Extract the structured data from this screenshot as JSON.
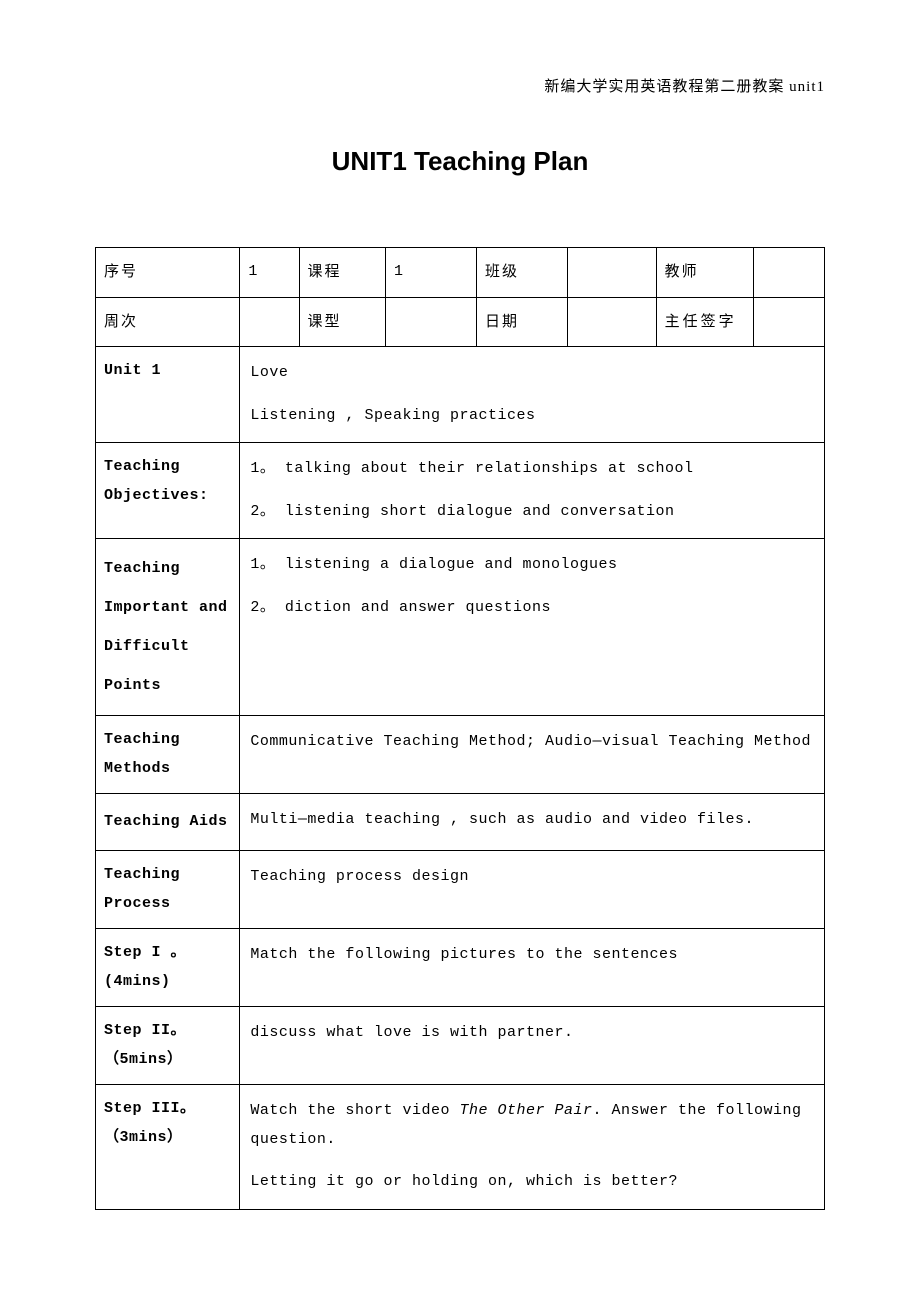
{
  "header": {
    "context": "新编大学实用英语教程第二册教案 unit1"
  },
  "title": "UNIT1 Teaching Plan",
  "row1": {
    "label": "序号",
    "val1": "1",
    "label2": "课程",
    "val2": "1",
    "label3": "班级",
    "val3": "",
    "label4": "教师",
    "val4": ""
  },
  "row2": {
    "label": "周次",
    "val1": "",
    "label2": "课型",
    "val2": "",
    "label3": "日期",
    "val3": "",
    "label4": "主任签字",
    "val4": ""
  },
  "unit": {
    "label": "Unit 1",
    "line1": "Love",
    "line2": "Listening , Speaking practices"
  },
  "objectives": {
    "label": "Teaching Objectives:",
    "line1": "1。  talking about their relationships at school",
    "line2": "2。  listening short dialogue and conversation"
  },
  "points": {
    "label": "Teaching Important and Difficult Points",
    "line1": "1。  listening a dialogue and monologues",
    "line2": "2。  diction and answer questions"
  },
  "methods": {
    "label": "Teaching Methods",
    "content": "Communicative Teaching Method;  Audio—visual Teaching Method"
  },
  "aids": {
    "label": "Teaching Aids",
    "content": "Multi—media teaching  , such as audio and video files."
  },
  "process": {
    "label": "Teaching Process",
    "content": "Teaching process design"
  },
  "step1": {
    "label": "Step I 。(4mins)",
    "content": "Match the following pictures to the sentences"
  },
  "step2": {
    "label": "Step II。（5mins）",
    "content": "discuss what love is with partner."
  },
  "step3": {
    "label": "Step III。（3mins）",
    "pre": "Watch the short video ",
    "italic": "The Other Pair",
    "post": ". Answer the following question.",
    "line2": "Letting it go or holding on, which is better?"
  }
}
